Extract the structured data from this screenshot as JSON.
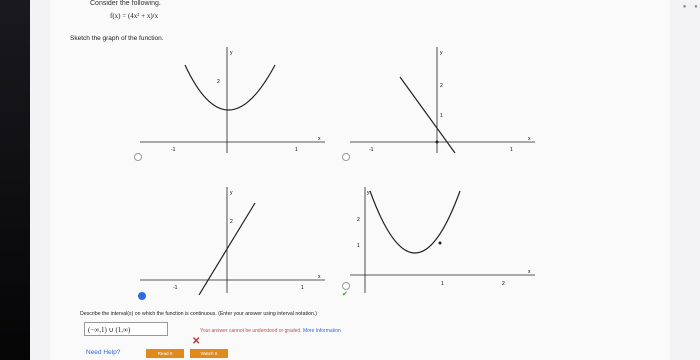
{
  "header": {
    "title_partial": "Consider the following."
  },
  "problem": {
    "function": "f(x) = (4x² + x)/x",
    "prompt": "Sketch the graph of the function."
  },
  "graphs": [
    {
      "axis_x": "x",
      "axis_y": "y",
      "labels": [
        "2",
        "-1",
        "1"
      ],
      "selected": false
    },
    {
      "axis_x": "x",
      "axis_y": "y",
      "labels": [
        "2",
        "1",
        "-1",
        "1"
      ],
      "selected": false
    },
    {
      "axis_x": "x",
      "axis_y": "y",
      "labels": [
        "2",
        "-1",
        "1"
      ],
      "selected": true
    },
    {
      "axis_x": "x",
      "axis_y": "y",
      "labels": [
        "2",
        "1",
        "1",
        "2"
      ],
      "selected": false
    }
  ],
  "question": {
    "describe": "Describe the interval(s) on which the function is continuous. (Enter your answer using interval notation.)",
    "answer_value": "(−∞,1) ∪ (1,∞)",
    "feedback_text": "Your answer cannot be understood or graded.",
    "feedback_link": "More Information"
  },
  "footer": {
    "need_help": "Need Help?",
    "read_it": "Read It",
    "watch_it": "Watch It"
  }
}
